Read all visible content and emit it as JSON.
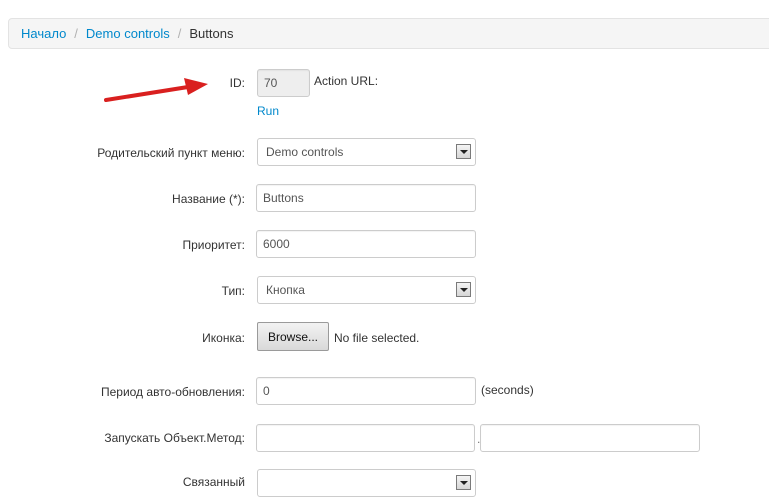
{
  "breadcrumb": {
    "home": "Начало",
    "parent": "Demo controls",
    "current": "Buttons",
    "separator": "/"
  },
  "form": {
    "id": {
      "label": "ID:",
      "value": "70"
    },
    "action_url": {
      "label": "Action URL:",
      "run_link": "Run"
    },
    "parent_menu": {
      "label": "Родительский пункт меню:",
      "selected": "Demo controls"
    },
    "name": {
      "label": "Название (*):",
      "value": "Buttons"
    },
    "priority": {
      "label": "Приоритет:",
      "value": "6000"
    },
    "type": {
      "label": "Тип:",
      "selected": "Кнопка"
    },
    "icon": {
      "label": "Иконка:",
      "browse_label": "Browse...",
      "file_status": "No file selected."
    },
    "auto_refresh": {
      "label": "Период авто-обновления:",
      "value": "0",
      "unit": "(seconds)"
    },
    "run_object_method": {
      "label": "Запускать Объект.Метод:",
      "object_value": "",
      "method_value": "",
      "separator": "."
    },
    "partial": {
      "label": "Связанный"
    }
  },
  "colors": {
    "link": "#0088cc",
    "arrow": "#d9201f",
    "breadcrumb_bg": "#f5f5f5"
  }
}
